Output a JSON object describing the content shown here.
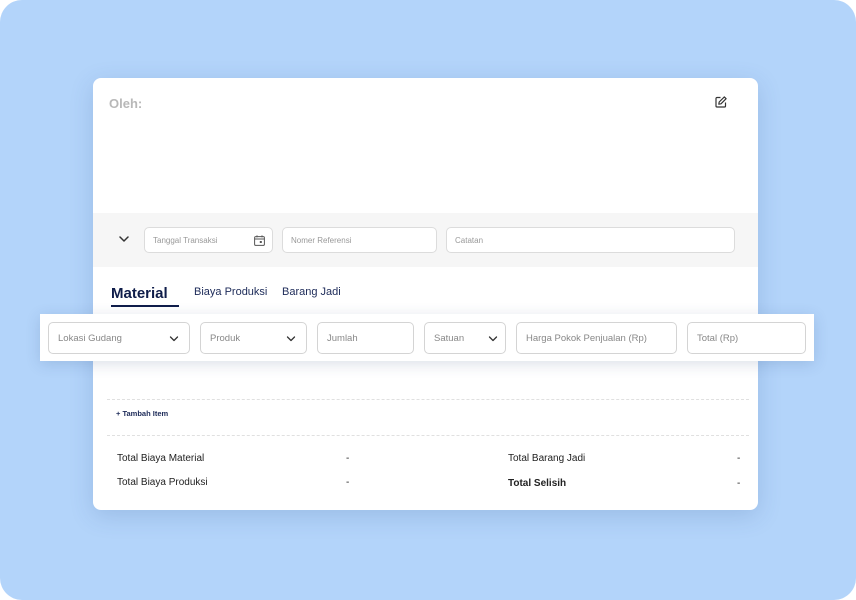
{
  "header": {
    "oleh_label": "Oleh:"
  },
  "filters": {
    "tanggal_placeholder": "Tanggal Transaksi",
    "referensi_placeholder": "Nomer Referensi",
    "catatan_placeholder": "Catatan"
  },
  "tabs": [
    {
      "label": "Material",
      "active": true
    },
    {
      "label": "Biaya Produksi",
      "active": false
    },
    {
      "label": "Barang Jadi",
      "active": false
    }
  ],
  "row": {
    "lokasi_gudang": "Lokasi Gudang",
    "produk": "Produk",
    "jumlah": "Jumlah",
    "satuan": "Satuan",
    "harga_pokok": "Harga Pokok Penjualan (Rp)",
    "total": "Total (Rp)"
  },
  "actions": {
    "add_item": "+ Tambah Item"
  },
  "summary": {
    "total_biaya_material": {
      "label": "Total Biaya Material",
      "value": "-"
    },
    "total_biaya_produksi": {
      "label": "Total Biaya Produksi",
      "value": "-"
    },
    "total_barang_jadi": {
      "label": "Total Barang Jadi",
      "value": "-"
    },
    "total_selisih": {
      "label": "Total Selisih",
      "value": "-"
    }
  },
  "colors": {
    "background": "#b3d4fa",
    "accent": "#0f1d4a"
  }
}
